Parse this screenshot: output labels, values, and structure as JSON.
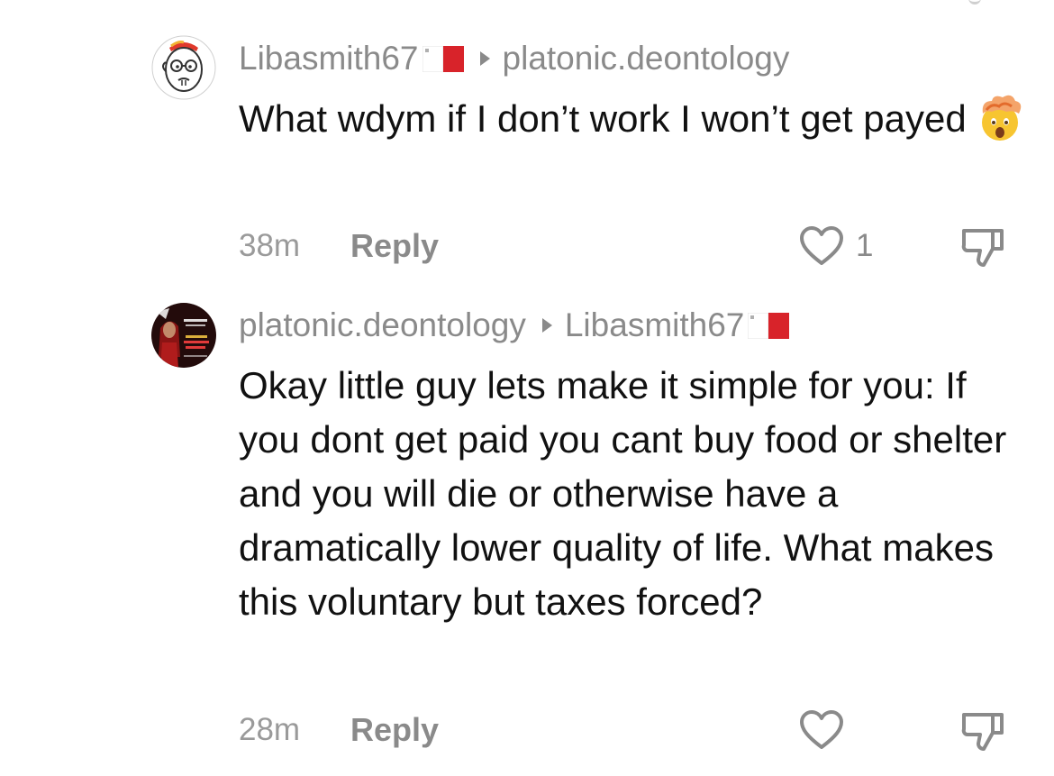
{
  "comments": [
    {
      "username": "Libasmith67",
      "reply_to": "platonic.deontology",
      "text": "What wdym if I don’t work I won’t get payed",
      "emoji": "exploding-head",
      "time": "38m",
      "reply_label": "Reply",
      "like_count": "1"
    },
    {
      "username": "platonic.deontology",
      "reply_to": "Libasmith67",
      "text": "Okay little guy lets make it simple for you: If you dont get paid you cant buy food or shelter and you will die or otherwise have a dramatically lower quality of life. What makes this voluntary but taxes forced?",
      "time": "28m",
      "reply_label": "Reply",
      "like_count": ""
    }
  ],
  "colors": {
    "muted_text": "#8a8a8a",
    "body_text": "#111111",
    "flag_red": "#d8232a"
  },
  "icons": [
    "heart-icon",
    "dislike-icon",
    "malta-flag-icon",
    "reply-arrow-icon",
    "exploding-head-emoji"
  ]
}
